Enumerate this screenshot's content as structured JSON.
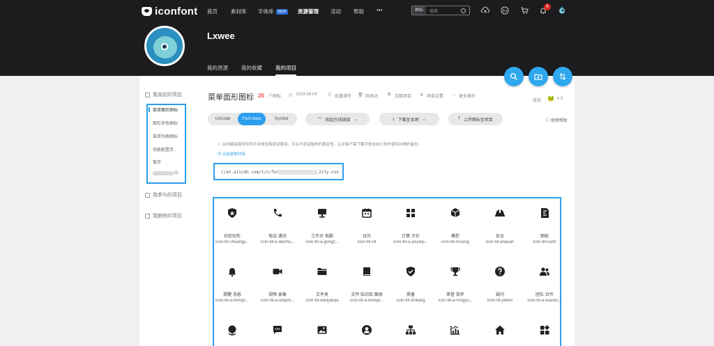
{
  "nav": {
    "logo": "iconfont",
    "items": [
      "首页",
      "素材库",
      "字体库",
      "资源管理",
      "活动",
      "帮助"
    ],
    "new_badge": "NEW",
    "more": "•••",
    "search_type": "图标",
    "search_placeholder": "搜索",
    "cart_count": "6"
  },
  "profile": {
    "username": "Lxwee",
    "tabs": [
      "我的资源",
      "我的收藏",
      "我的项目"
    ]
  },
  "sidebar": {
    "started": "我发起的项目",
    "projects": [
      "菜单面形图标",
      "图形多色图标",
      "菜单列表图标",
      "功能配置页...",
      "暂存"
    ],
    "blurred_suffix": "IC",
    "joined": "我参与的项目",
    "deleted": "我删除的项目"
  },
  "project": {
    "title": "菜单面形图标",
    "count": "26",
    "count_label": "个图标",
    "date": "2023-09-04",
    "actions": [
      "批量操作",
      "回收站",
      "克隆项目",
      "项目设置",
      "更多操作"
    ],
    "members_label": "成员:",
    "members_count": "x 3"
  },
  "controls": {
    "segments": [
      "Unicode",
      "Font class",
      "Symbol"
    ],
    "collapse": "收起在线链接",
    "download": "下载至本地",
    "upload": "上传图标至项目",
    "help": "使用帮助"
  },
  "notice": "在线链接服务仅供平台体验和调试使用，平台不承诺服务的稳定性，企业客户需下载字体包自行发布使用并做好备份。",
  "copy_code": "点此复制代码",
  "css_link_start": "//at.alicdn.com/t/c/fon",
  "css_link_end": "2z7y.css",
  "icons": [
    {
      "name": "创优创先",
      "code": "icon-fill-chuangy..."
    },
    {
      "name": "电话 通讯",
      "code": "icon-fill-a-dianhu..."
    },
    {
      "name": "工作台 电脑",
      "code": "icon-fill-a-gongz..."
    },
    {
      "name": "日历",
      "code": "icon-fill-rili"
    },
    {
      "name": "计算 计价",
      "code": "icon-fill-a-jisuanji..."
    },
    {
      "name": "模型",
      "code": "icon-fill-moxing"
    },
    {
      "name": "安全",
      "code": "icon-fill-anquan"
    },
    {
      "name": "图纸",
      "code": "icon-fill-tuzhi"
    },
    {
      "name": "提醒 消息",
      "code": "icon-fill-a-tixingx..."
    },
    {
      "name": "视频 录像",
      "code": "icon-fill-a-shipinl..."
    },
    {
      "name": "文件夹",
      "code": "icon-fill-wenjianjia"
    },
    {
      "name": "文件 知识库 面册",
      "code": "icon-fill-a-wenjia..."
    },
    {
      "name": "质量",
      "code": "icon-fill-zhiliang"
    },
    {
      "name": "荣誉 奖杯",
      "code": "icon-fill-a-rongyu..."
    },
    {
      "name": "疑问",
      "code": "icon-fill-yiwen"
    },
    {
      "name": "团队 合作",
      "code": "icon-fill-a-tuandu..."
    },
    {
      "name": "",
      "code": ""
    },
    {
      "name": "",
      "code": ""
    },
    {
      "name": "",
      "code": ""
    },
    {
      "name": "",
      "code": ""
    },
    {
      "name": "",
      "code": ""
    },
    {
      "name": "",
      "code": ""
    },
    {
      "name": "",
      "code": ""
    },
    {
      "name": "",
      "code": ""
    }
  ],
  "colors": {
    "accent": "#2b9ded",
    "header_bg": "#1c1c1f",
    "count_red": "#e8534d"
  }
}
